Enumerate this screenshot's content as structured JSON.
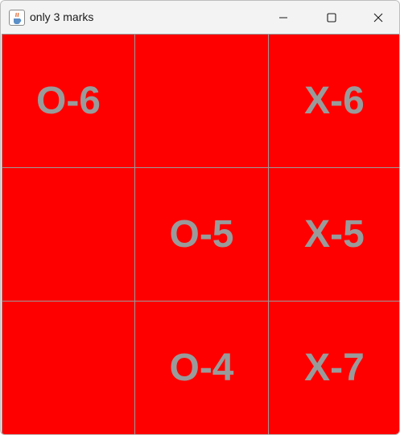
{
  "window": {
    "title": "only 3 marks",
    "app_icon": "java-cup-icon",
    "controls": [
      "minimize-icon",
      "maximize-icon",
      "close-icon"
    ]
  },
  "colors": {
    "cell_background": "#ff0000",
    "mark_text": "#9a9a9a",
    "grid_lines": "#8c8c8c",
    "titlebar": "#f3f3f3"
  },
  "board": {
    "rows": [
      [
        "O-6",
        "",
        "X-6"
      ],
      [
        "",
        "O-5",
        "X-5"
      ],
      [
        "",
        "O-4",
        "X-7"
      ]
    ]
  }
}
